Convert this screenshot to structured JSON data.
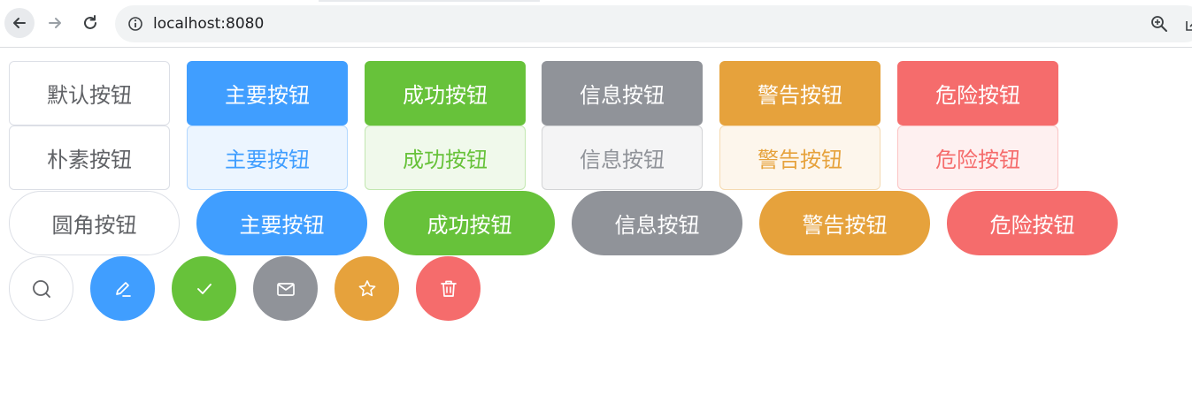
{
  "browser": {
    "url": "localhost:8080"
  },
  "rows": {
    "basic": [
      "默认按钮",
      "主要按钮",
      "成功按钮",
      "信息按钮",
      "警告按钮",
      "危险按钮"
    ],
    "plain": [
      "朴素按钮",
      "主要按钮",
      "成功按钮",
      "信息按钮",
      "警告按钮",
      "危险按钮"
    ],
    "round": [
      "圆角按钮",
      "主要按钮",
      "成功按钮",
      "信息按钮",
      "警告按钮",
      "危险按钮"
    ]
  },
  "circle_icons": [
    "search-icon",
    "edit-icon",
    "check-icon",
    "message-icon",
    "star-icon",
    "delete-icon"
  ],
  "colors": {
    "primary": "#409eff",
    "success": "#67c23a",
    "info": "#909399",
    "warning": "#e6a23c",
    "danger": "#f56c6c",
    "default_text": "#606266",
    "default_border": "#dcdfe6"
  }
}
